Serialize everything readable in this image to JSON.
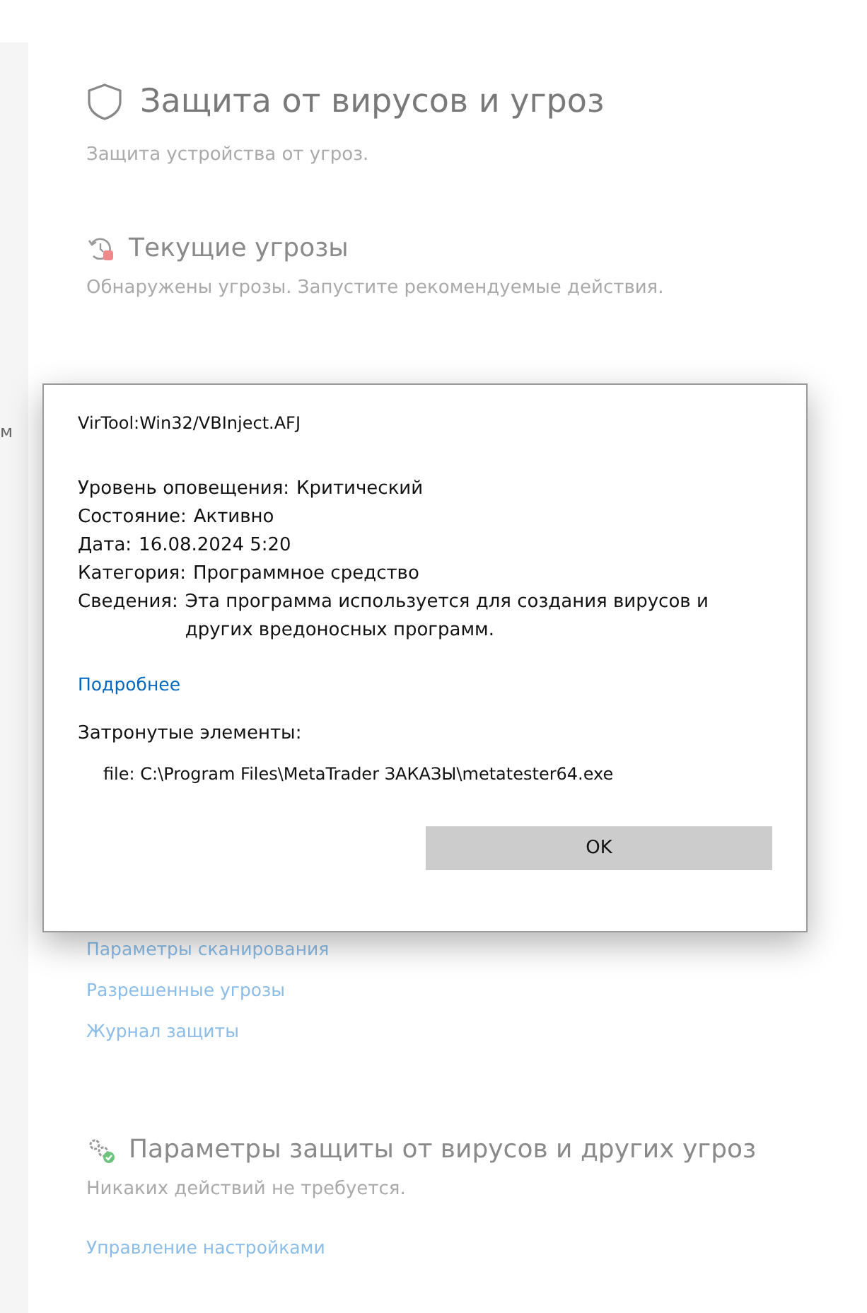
{
  "sidebar": {
    "items": [
      {
        "label": "м"
      }
    ]
  },
  "page": {
    "title": "Защита от вирусов и угроз",
    "subtitle": "Защита устройства от угроз.",
    "sections": [
      {
        "kind": "threats",
        "heading": "Текущие угрозы",
        "text": "Обнаружены угрозы. Запустите рекомендуемые действия.",
        "links": [
          "Параметры сканирования",
          "Разрешенные угрозы",
          "Журнал защиты"
        ]
      },
      {
        "kind": "settings",
        "heading": "Параметры защиты от вирусов и других угроз",
        "text": "Никаких действий не требуется.",
        "links": [
          "Управление настройками"
        ]
      }
    ]
  },
  "dialog": {
    "threat_name": "VirTool:Win32/VBInject.AFJ",
    "fields": [
      {
        "label": "Уровень оповещения:",
        "value": "Критический"
      },
      {
        "label": "Состояние:",
        "value": "Активно"
      },
      {
        "label": "Дата:",
        "value": "16.08.2024 5:20"
      },
      {
        "label": "Категория:",
        "value": "Программное средство"
      },
      {
        "label": "Сведения:",
        "value": "Эта программа используется для создания вирусов и других вредоносных программ."
      }
    ],
    "link": "Подробнее",
    "affected_label": "Затронутые элементы:",
    "affected_items": [
      "file: C:\\Program Files\\MetaTrader ЗАКАЗЫ\\metatester64.exe"
    ],
    "button": "OK"
  }
}
